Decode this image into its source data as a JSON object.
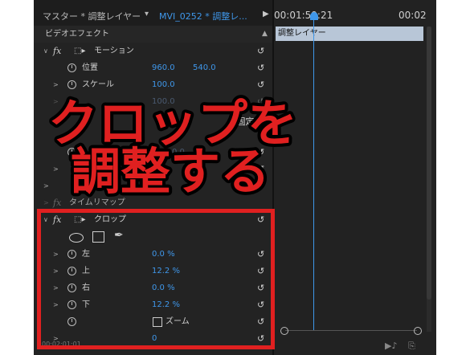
{
  "header": {
    "master_label": "マスター * 調整レイヤー",
    "clip_label": "MVI_0252 * 調整レ...",
    "chevron_icon": "chevron-down-icon",
    "play_icon": "play-icon"
  },
  "timeline": {
    "current_time": "00:01:59:21",
    "end_time": "00:02",
    "clip_name": "調整レイヤー"
  },
  "panel": {
    "section_title": "ビデオエフェクト",
    "collapse_icon": "collapse-up-icon"
  },
  "effects": {
    "motion": {
      "name": "モーション",
      "position_label": "位置",
      "position_x": "960.0",
      "position_y": "540.0",
      "scale_label": "スケール",
      "scale_value": "100.0",
      "scale_width_value": "100.0",
      "obscured_value": "0.0"
    },
    "time_remap": "タイムリマップ",
    "crop": {
      "name": "クロップ",
      "left_label": "左",
      "left_value": "0.0 %",
      "top_label": "上",
      "top_value": "12.2 %",
      "right_label": "右",
      "right_value": "0.0 %",
      "bottom_label": "下",
      "bottom_value": "12.2 %",
      "zoom_label": "ズーム",
      "edge_feather_value": "0"
    }
  },
  "status_time": "00:02:01:01",
  "overlay": {
    "line1": "クロップを",
    "line2": "調整する",
    "fragment": "を固定",
    "accent_color": "#e02020"
  }
}
